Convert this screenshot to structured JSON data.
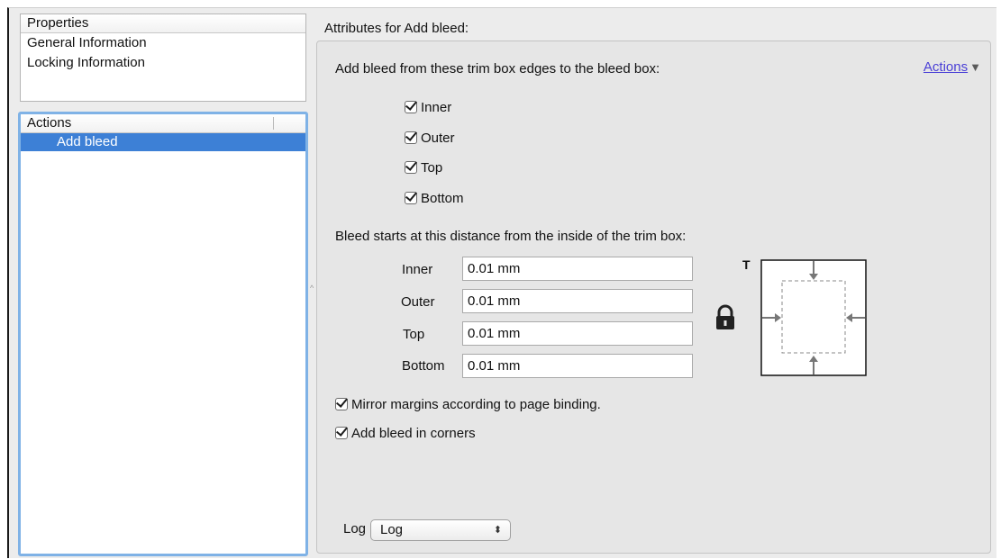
{
  "sidebar": {
    "properties_header": "Properties",
    "properties_items": [
      "General Information",
      "Locking Information"
    ],
    "actions_header": "Actions",
    "selected_action": "Add bleed"
  },
  "attributes": {
    "title": "Attributes for Add bleed:",
    "actions_link": "Actions",
    "edges_label": "Add bleed from these trim box edges to the bleed box:",
    "edges": [
      {
        "label": "Inner",
        "checked": true
      },
      {
        "label": "Outer",
        "checked": true
      },
      {
        "label": "Top",
        "checked": true
      },
      {
        "label": "Bottom",
        "checked": true
      }
    ],
    "distance_label": "Bleed starts at this distance from the inside of the trim box:",
    "fields": [
      {
        "label": "Inner",
        "value": "0.01 mm"
      },
      {
        "label": "Outer",
        "value": "0.01 mm"
      },
      {
        "label": "Top",
        "value": "0.01 mm"
      },
      {
        "label": "Bottom",
        "value": "0.01 mm"
      }
    ],
    "diagram_label": "T",
    "mirror_label": "Mirror margins according to page binding.",
    "mirror_checked": true,
    "corners_label": "Add bleed in corners",
    "corners_checked": true,
    "log_label": "Log",
    "log_value": "Log"
  },
  "icons": {
    "lock": "lock-icon",
    "diagram": "bleed-diagram-icon",
    "dropdown": "up-down-arrows-icon",
    "disclosure": "triangle-down-icon"
  }
}
